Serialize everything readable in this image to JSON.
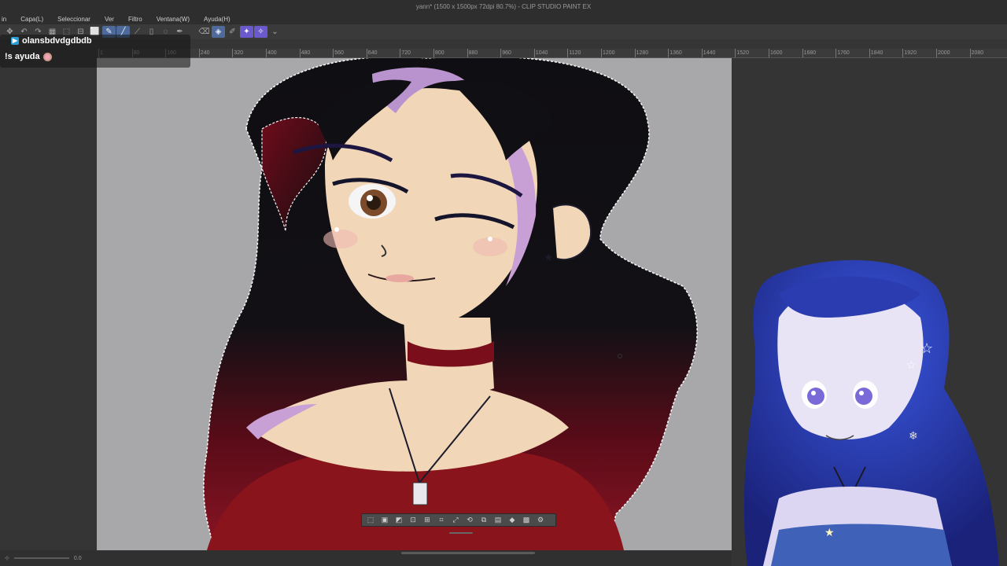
{
  "window": {
    "title": "yann* (1500 x 1500px 72dpi 80.7%)  - CLIP STUDIO PAINT EX"
  },
  "menu": {
    "items": [
      "in",
      "Capa(L)",
      "Seleccionar",
      "Ver",
      "Filtro",
      "Ventana(W)",
      "Ayuda(H)"
    ]
  },
  "command_bar": {
    "icons": [
      "move-icon",
      "undo-icon",
      "redo-icon",
      "grid-icon",
      "rect-icon",
      "rect-icon",
      "select-icon",
      "pen-icon",
      "wand-icon",
      "ruler-icon",
      "lasso-icon",
      "pen-nib-icon",
      "dropdown-icon",
      "color-swatch-black",
      "eraser-icon",
      "fill-icon",
      "pen-icon",
      "brush-icon",
      "sparkle-icon"
    ]
  },
  "ruler": {
    "ticks": [
      "1",
      "80",
      "160",
      "240",
      "320",
      "400",
      "480",
      "560",
      "640",
      "720",
      "800",
      "880",
      "960",
      "1040",
      "1120",
      "1200",
      "1280",
      "1360",
      "1440",
      "1520",
      "1600",
      "1680",
      "1760",
      "1840",
      "1920",
      "2000",
      "2080"
    ]
  },
  "chat_overlay": {
    "username": "olansbdvdgdbdb",
    "message": "!s ayuda",
    "accent": "#2a9fd6"
  },
  "selection_toolbar": {
    "icons": [
      "deselect-icon",
      "invert-selection-icon",
      "expand-icon",
      "shrink-icon",
      "transform-icon",
      "crop-icon",
      "scale-icon",
      "rotate-icon",
      "copy-icon",
      "paste-icon",
      "fill-icon",
      "pattern-icon",
      "settings-icon"
    ]
  },
  "status_bar": {
    "zoom": "0.0"
  },
  "colors": {
    "hair": "#111014",
    "hair_red": "#7a0f1f",
    "skin": "#f1d6b8",
    "shadow_lilac": "#c9a0d6",
    "shirt": "#8a141c",
    "canvas_bg": "#a8a8aa",
    "vtuber_hair": "#2a3cb0"
  }
}
